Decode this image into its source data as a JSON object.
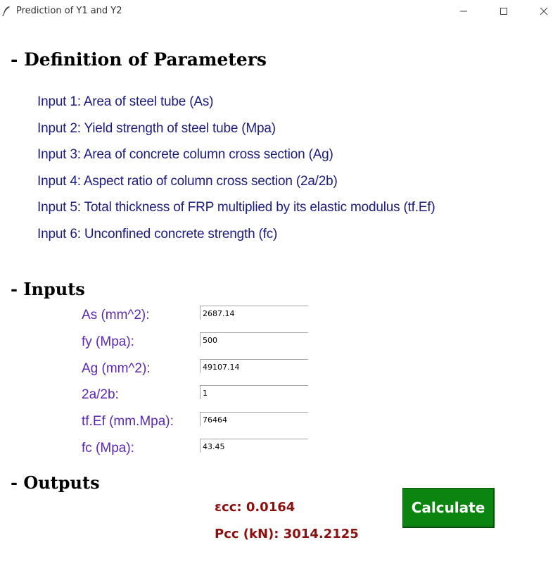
{
  "window": {
    "title": "Prediction of Y1 and Y2",
    "controls": [
      "minimize-icon",
      "maximize-icon",
      "close-icon"
    ]
  },
  "definition": {
    "heading": "- Definition of Parameters",
    "items": [
      "Input 1:  Area of steel tube (As)",
      "Input 2: Yield strength of steel tube (Mpa)",
      "Input 3: Area of concrete column cross section (Ag)",
      "Input 4: Aspect ratio of column cross section (2a/2b)",
      "Input 5: Total thickness of FRP multiplied by its elastic modulus (tf.Ef)",
      "Input 6: Unconfined concrete strength (fc)"
    ]
  },
  "inputs": {
    "heading": "- Inputs",
    "fields": [
      {
        "label": "As (mm^2):",
        "value": "2687.14"
      },
      {
        "label": "fy (Mpa):",
        "value": "500"
      },
      {
        "label": "Ag (mm^2):",
        "value": "49107.14"
      },
      {
        "label": "2a/2b:",
        "value": "1"
      },
      {
        "label": "tf.Ef (mm.Mpa):",
        "value": "76464"
      },
      {
        "label": "fc (Mpa):",
        "value": "43.45"
      }
    ]
  },
  "outputs": {
    "heading": "- Outputs",
    "ecc": "εcc: 0.0164",
    "pcc": "Pcc (kN): 3014.2125",
    "calculate_label": "Calculate"
  },
  "colors": {
    "definition_text": "#1c1c7c",
    "input_label": "#5a2ab0",
    "output_text": "#8b0f0f",
    "button_bg": "#0c8410"
  }
}
